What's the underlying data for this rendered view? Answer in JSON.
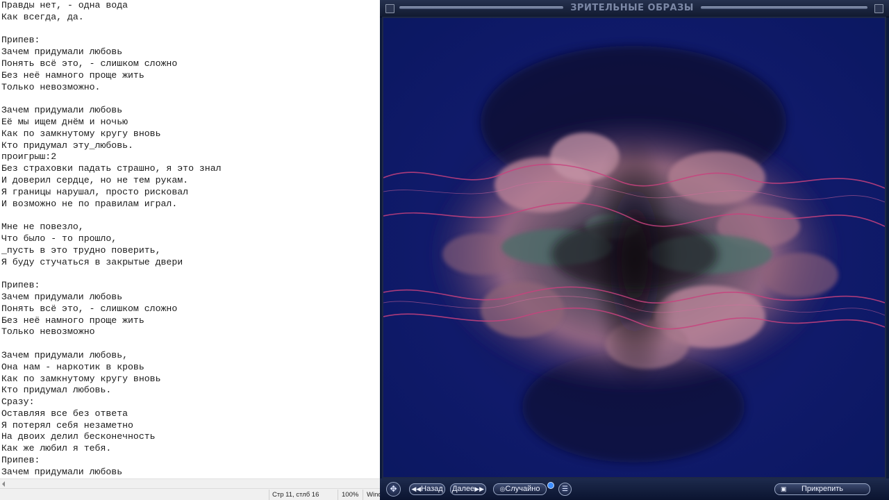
{
  "notepad": {
    "lines": [
      "Правды нет, - одна вода",
      "Как всегда, да.",
      "",
      "Припев:",
      "Зачем придумали любовь",
      "Понять всё это, - слишком сложно",
      "Без неё намного проще жить",
      "Только невозможно.",
      "",
      "Зачем придумали любовь",
      "Её мы ищем днём и ночью",
      "Как по замкнутому кругу вновь",
      "Кто придумал эту_любовь.",
      "проигрыш:2",
      "Без страховки падать страшно, я это знал",
      "И доверил сердце, но не тем рукам.",
      "Я границы нарушал, просто рисковал",
      "И возможно не по правилам играл.",
      "",
      "Мне не повезло,",
      "Что было - то прошло,",
      "_пусть в это трудно поверить,",
      "Я буду стучаться в закрытые двери",
      "",
      "Припев:",
      "Зачем придумали любовь",
      "Понять всё это, - слишком сложно",
      "Без неё намного проще жить",
      "Только невозможно",
      "",
      "Зачем придумали любовь,",
      "Она нам - наркотик в кровь",
      "Как по замкнутому кругу вновь",
      "Кто придумал любовь.",
      "Сразу:",
      "Оставляя все без ответа",
      "Я потерял себя незаметно",
      "На двоих делил бесконечность",
      "Как же любил я тебя.",
      "Припев:",
      "Зачем придумали любовь"
    ],
    "status": {
      "position": "Стр 11, стлб 16",
      "zoom": "100%",
      "encoding": "Wind"
    }
  },
  "visualizer": {
    "title": "ЗРИТЕЛЬНЫЕ ОБРАЗЫ",
    "buttons": {
      "back": "Назад",
      "next": "Далее",
      "random": "Случайно",
      "pin": "Прикрепить"
    },
    "icons": {
      "close": "close-icon",
      "move": "move-icon",
      "menu": "menu-icon",
      "pin": "pin-icon"
    },
    "colors": {
      "background": "#0a1440",
      "blob_pink": "#b07a90",
      "blob_teal": "#4f6e6a",
      "wave": "#c0407a"
    }
  }
}
